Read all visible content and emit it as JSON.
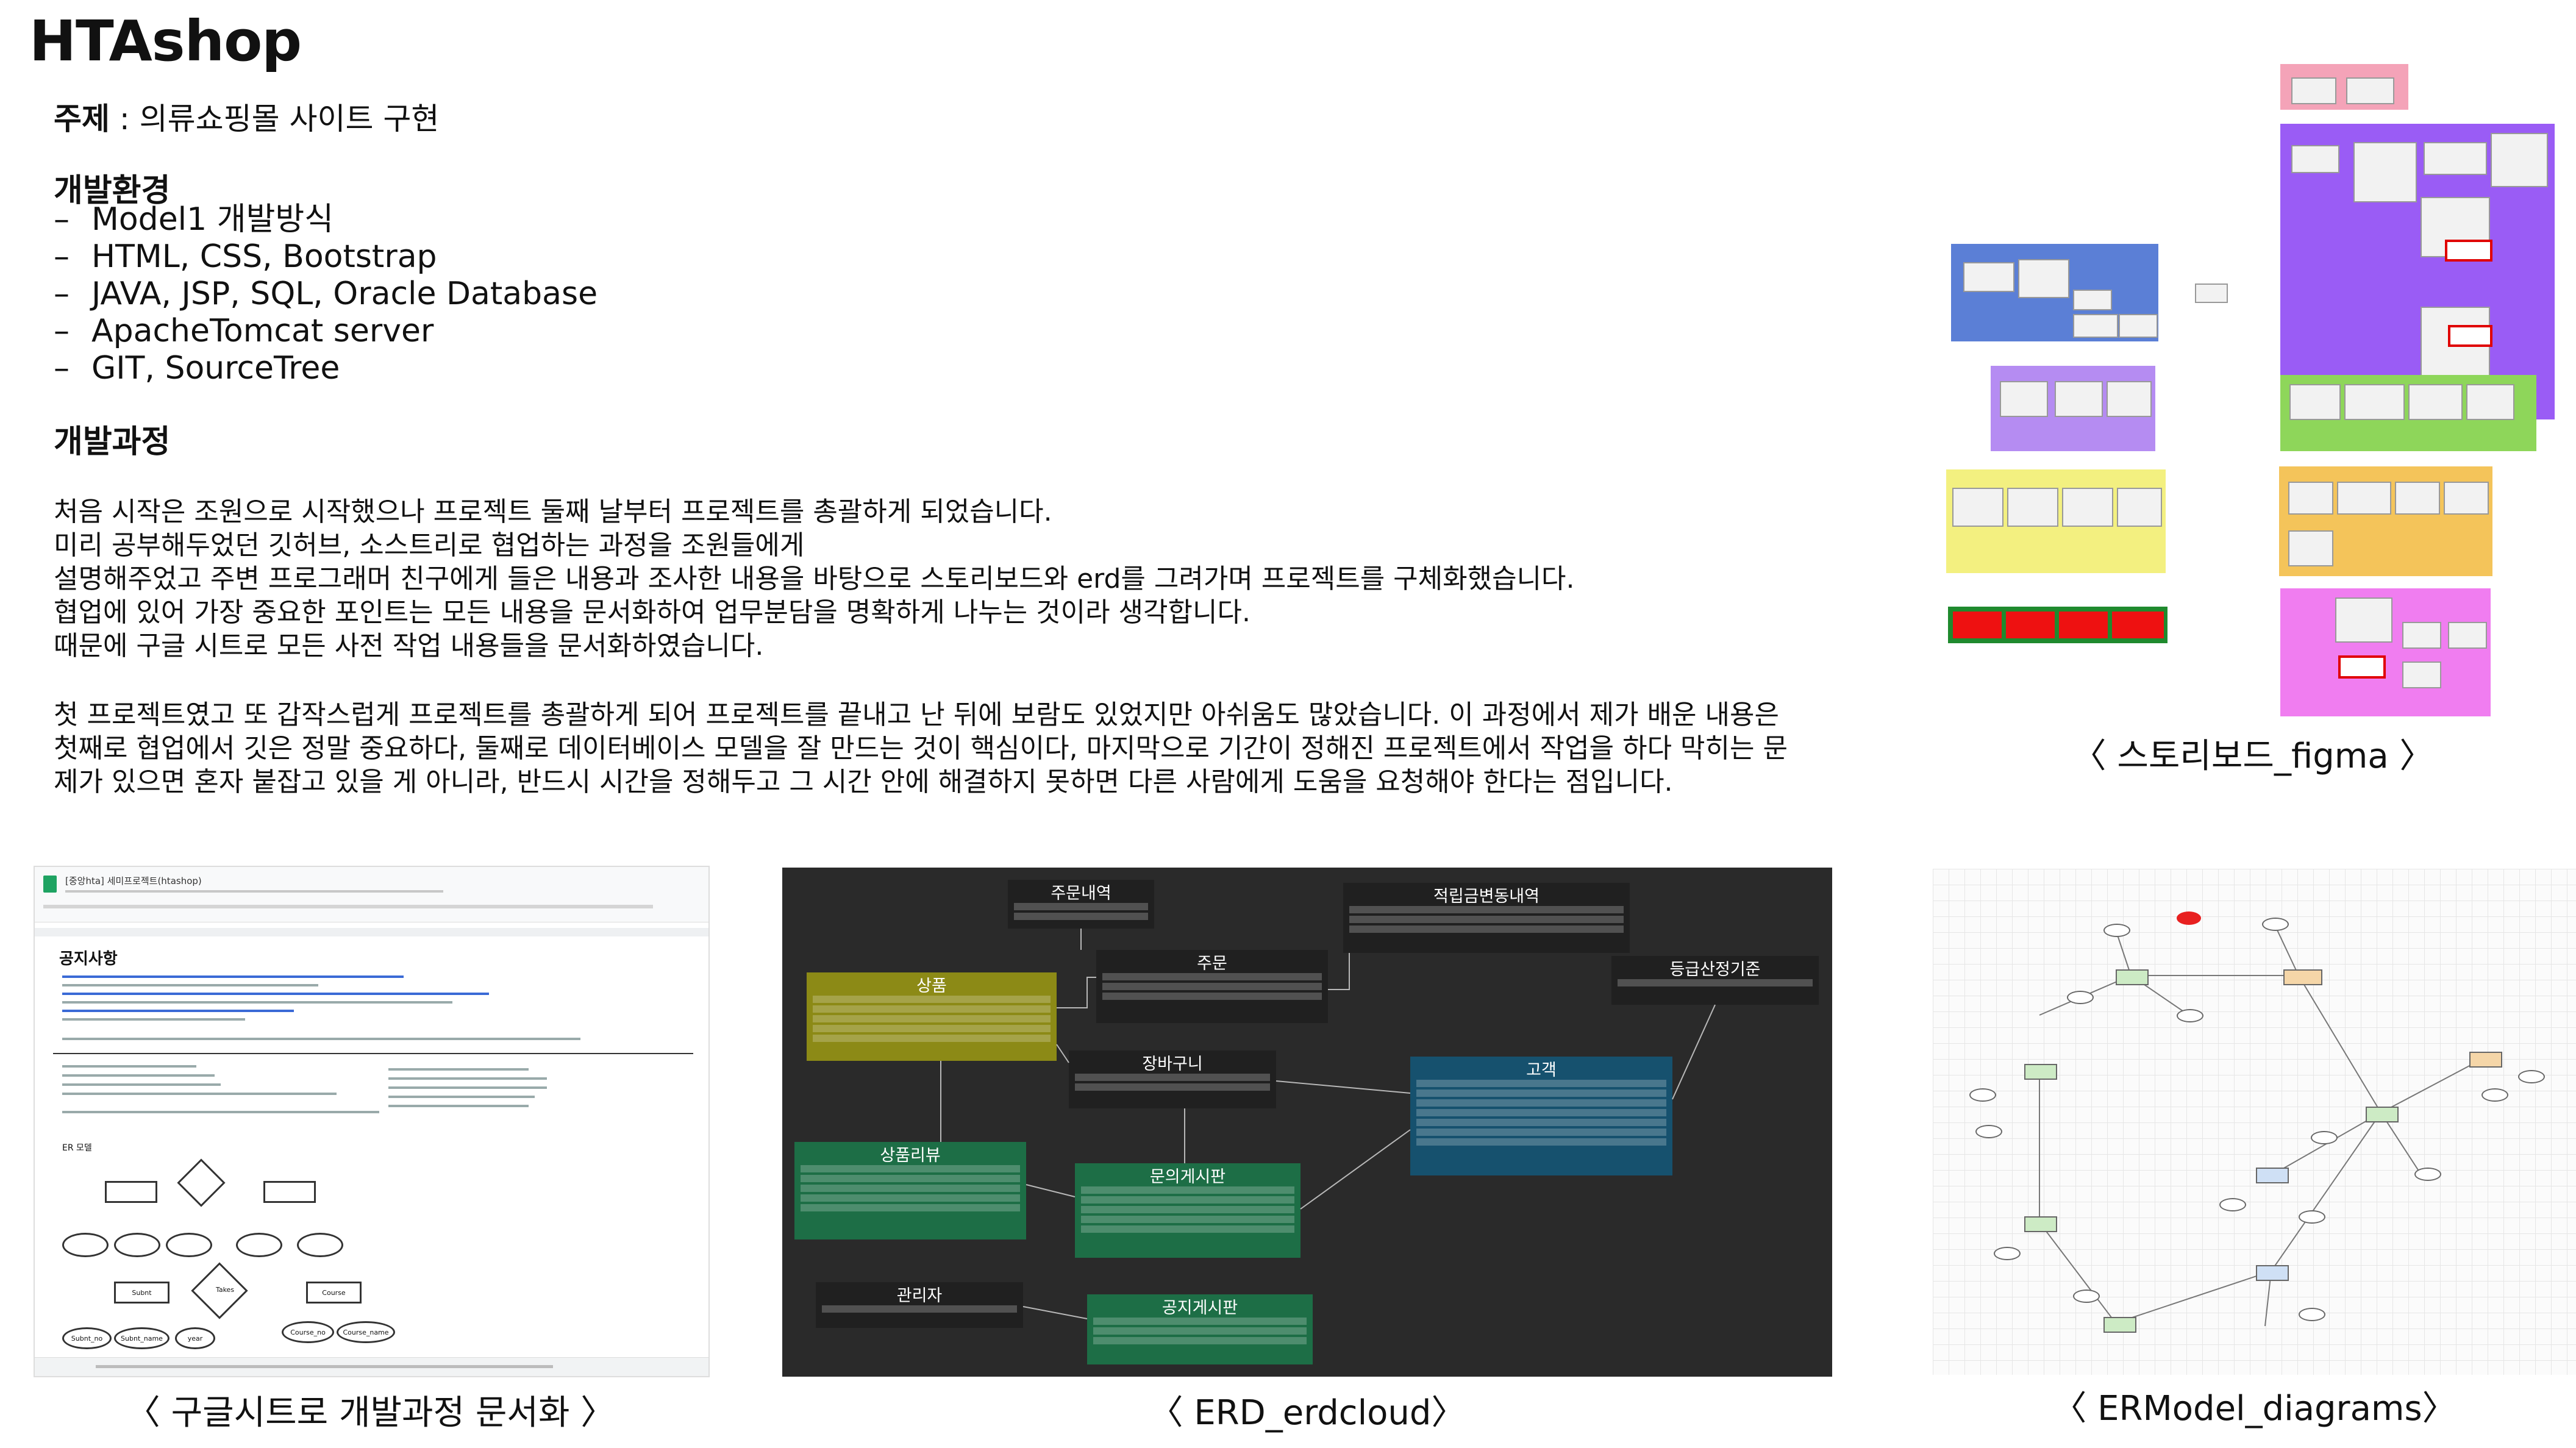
{
  "title": "HTAshop",
  "topic": {
    "label": "주제",
    "text": " : 의류쇼핑몰 사이트 구현"
  },
  "environment": {
    "heading": "개발환경",
    "items": [
      "Model1 개발방식",
      "HTML, CSS, Bootstrap",
      "JAVA, JSP, SQL, Oracle Database",
      "ApacheTomcat server",
      "GIT, SourceTree"
    ]
  },
  "process": {
    "heading": "개발과정",
    "paragraph1": [
      "처음 시작은 조원으로 시작했으나 프로젝트 둘째 날부터 프로젝트를 총괄하게 되었습니다.",
      "미리 공부해두었던 깃허브, 소스트리로 협업하는 과정을 조원들에게",
      "설명해주었고 주변 프로그래머 친구에게 들은 내용과 조사한 내용을 바탕으로 스토리보드와 erd를 그려가며 프로젝트를 구체화했습니다.",
      "협업에 있어 가장 중요한 포인트는 모든 내용을 문서화하여 업무분담을 명확하게 나누는 것이라 생각합니다.",
      "때문에 구글 시트로 모든 사전 작업 내용들을 문서화하였습니다."
    ],
    "paragraph2": [
      "첫 프로젝트였고 또 갑작스럽게 프로젝트를 총괄하게 되어 프로젝트를 끝내고 난 뒤에 보람도 있었지만 아쉬움도 많았습니다. 이 과정에서 제가 배운 내용은",
      "첫째로 협업에서 깃은 정말 중요하다, 둘째로 데이터베이스 모델을 잘 만드는 것이 핵심이다, 마지막으로 기간이 정해진 프로젝트에서 작업을 하다 막히는 문",
      "제가 있으면 혼자 붙잡고 있을 게 아니라, 반드시 시간을 정해두고 그 시간 안에 해결하지 못하면 다른 사람에게 도움을 요청해야 한다는 점입니다."
    ]
  },
  "captions": {
    "figma": "〈 스토리보드_figma 〉",
    "sheet": "〈 구글시트로 개발과정 문서화 〉",
    "erd": "〈 ERD_erdcloud〉",
    "er": "〈 ERModel_diagrams〉"
  },
  "sheet": {
    "doc_title": "[중앙hta] 세미프로젝트(htashop)",
    "section_title": "공지사항",
    "er_label": "ER 모델",
    "entities": [
      "Subnt",
      "Course"
    ],
    "relation": "Takes",
    "attributes": [
      "Subnt_no",
      "Subnt_name",
      "year",
      "Course_no",
      "Course_name"
    ]
  },
  "erd": {
    "tables": [
      "주문내역",
      "적립금변동내역",
      "주문",
      "상품",
      "등급산정기준",
      "장바구니",
      "고객",
      "상품리뷰",
      "문의게시판",
      "관리자",
      "공지게시판"
    ]
  },
  "colors": {
    "figma_blue": "#5b7fd6",
    "figma_purple": "#9a5cf5",
    "figma_green": "#8ed65a",
    "figma_yellow": "#f3f080",
    "figma_orange": "#f4c45a",
    "figma_pink": "#f07df0",
    "figma_red": "#ee1111",
    "figma_lightpink": "#f4a3b8",
    "figma_lavender": "#b58cf2",
    "erd_background": "#2a2a2a",
    "erd_olive": "#8c8a16",
    "erd_teal": "#16516e",
    "erd_green": "#1d6e46",
    "erd_dark": "#202020"
  }
}
